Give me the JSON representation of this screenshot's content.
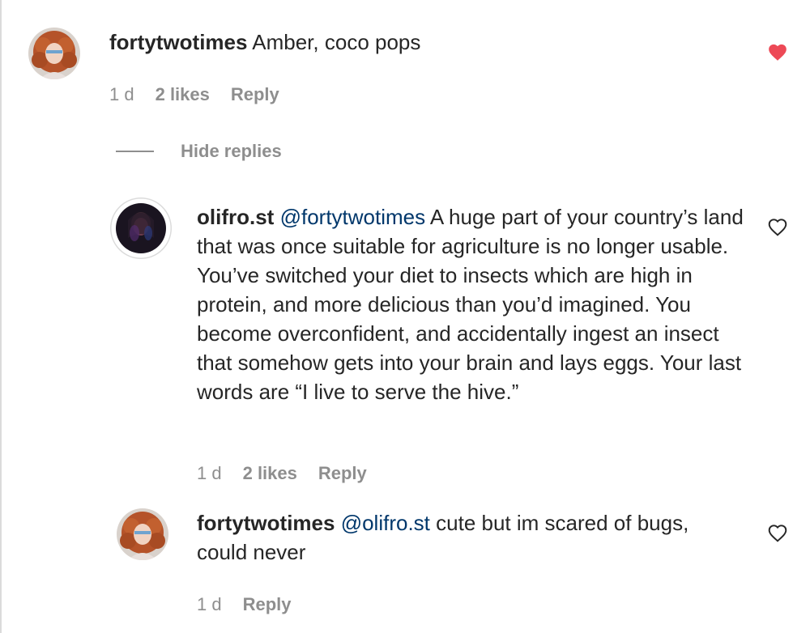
{
  "comments": [
    {
      "username": "fortytwotimes",
      "text": "Amber, coco pops",
      "time": "1 d",
      "likes": "2 likes",
      "reply": "Reply",
      "liked": true
    },
    {
      "username": "olifro.st",
      "mention": "@fortytwotimes",
      "text": "A huge part of your country’s land that was once suitable for agriculture is no longer usable. You’ve switched your diet to insects which are high in protein, and more delicious than you’d imagined. You become overconfident, and accidentally ingest an insect that somehow gets into your brain and lays eggs. Your last words are “I live to serve the hive.”",
      "time": "1 d",
      "likes": "2 likes",
      "reply": "Reply",
      "liked": false
    },
    {
      "username": "fortytwotimes",
      "mention": "@olifro.st",
      "text": "cute but im scared of bugs, could never",
      "time": "1 d",
      "reply": "Reply",
      "liked": false
    }
  ],
  "hide_replies": "Hide replies",
  "colors": {
    "liked_heart": "#ed4956",
    "text": "#262626",
    "meta": "#8e8e8e",
    "mention": "#00376b"
  }
}
